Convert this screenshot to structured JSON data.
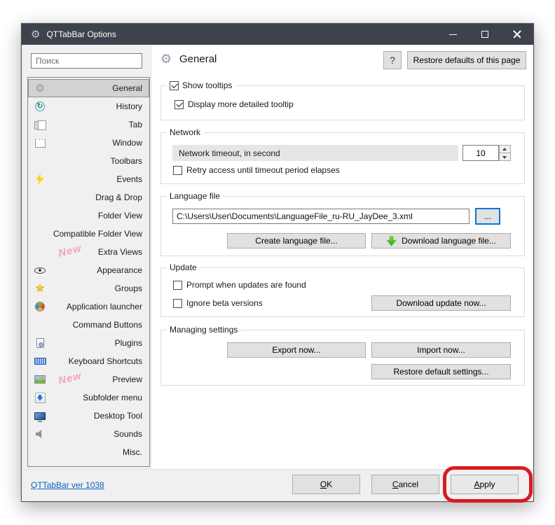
{
  "window": {
    "title": "QTTabBar Options"
  },
  "sidebar": {
    "search_placeholder": "Поиск",
    "items": [
      {
        "label": "General",
        "icon": "gear",
        "selected": true
      },
      {
        "label": "History",
        "icon": "history"
      },
      {
        "label": "Tab",
        "icon": "tab"
      },
      {
        "label": "Window",
        "icon": "window"
      },
      {
        "label": "Toolbars"
      },
      {
        "label": "Events",
        "icon": "lightning"
      },
      {
        "label": "Drag & Drop"
      },
      {
        "label": "Folder View"
      },
      {
        "label": "Compatible Folder View"
      },
      {
        "label": "Extra Views",
        "badge": "New"
      },
      {
        "label": "Appearance",
        "icon": "eye"
      },
      {
        "label": "Groups",
        "icon": "star"
      },
      {
        "label": "Application launcher",
        "icon": "pie"
      },
      {
        "label": "Command Buttons"
      },
      {
        "label": "Plugins",
        "icon": "plugin"
      },
      {
        "label": "Keyboard Shortcuts",
        "icon": "keyboard"
      },
      {
        "label": "Preview",
        "icon": "image",
        "badge": "New"
      },
      {
        "label": "Subfolder menu",
        "icon": "downarrow"
      },
      {
        "label": "Desktop Tool",
        "icon": "monitor"
      },
      {
        "label": "Sounds",
        "icon": "speaker"
      },
      {
        "label": "Misc."
      }
    ]
  },
  "header": {
    "title": "General",
    "help_label": "?",
    "restore_button": "Restore defaults of this page"
  },
  "tooltips_group": {
    "title": "Show tooltips",
    "title_checked": true,
    "detail_label": "Display more detailed tooltip",
    "detail_checked": true
  },
  "network_group": {
    "title": "Network",
    "timeout_label": "Network timeout, in second",
    "timeout_value": "10",
    "retry_label": "Retry access until timeout period elapses",
    "retry_checked": false
  },
  "language_group": {
    "title": "Language file",
    "path_value": "C:\\Users\\User\\Documents\\LanguageFile_ru-RU_JayDee_3.xml",
    "browse_label": "...",
    "create_button": "Create language file...",
    "download_button": "Download language file..."
  },
  "update_group": {
    "title": "Update",
    "prompt_label": "Prompt when updates are found",
    "prompt_checked": false,
    "beta_label": "Ignore beta versions",
    "beta_checked": false,
    "download_button": "Download update now..."
  },
  "managing_group": {
    "title": "Managing settings",
    "export_button": "Export now...",
    "import_button": "Import now...",
    "restore_button": "Restore default settings..."
  },
  "footer": {
    "version_link": "QTTabBar ver 1038",
    "ok": {
      "key": "O",
      "rest": "K"
    },
    "cancel": {
      "key": "C",
      "rest": "ancel"
    },
    "apply": {
      "key": "A",
      "rest": "pply"
    }
  },
  "annotation": {
    "type": "red-rounded-rectangle",
    "target": "apply-button",
    "color": "#da1a21"
  },
  "colors": {
    "titlebar": "#3d424d",
    "sidebar_bg": "#f0f0f0",
    "focus_border": "#0078d7",
    "link": "#0563c1",
    "badge_pink": "#f2a3c0"
  }
}
